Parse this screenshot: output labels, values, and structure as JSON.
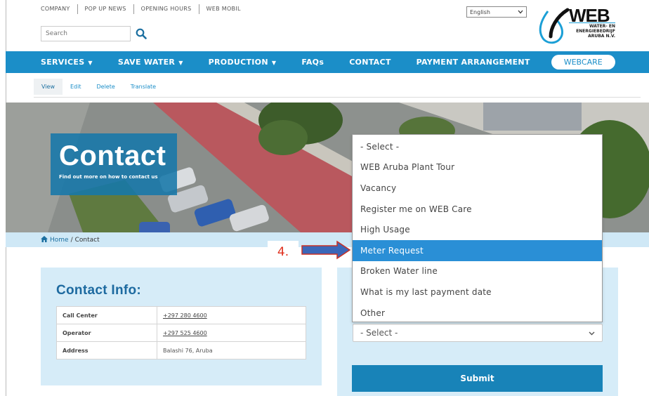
{
  "top_links": [
    "COMPANY",
    "POP UP NEWS",
    "OPENING HOURS",
    "WEB MOBIL"
  ],
  "search": {
    "placeholder": "Search"
  },
  "language": {
    "selected": "English"
  },
  "logo": {
    "text": "WEB",
    "subtitle_line1": "WATER- EN",
    "subtitle_line2": "ENERGIEBEDRIJF",
    "subtitle_line3": "ARUBA N.V."
  },
  "nav": {
    "items": [
      {
        "label": "SERVICES",
        "caret": "▼"
      },
      {
        "label": "SAVE WATER",
        "caret": "▼"
      },
      {
        "label": "PRODUCTION",
        "caret": "▼"
      },
      {
        "label": "FAQs",
        "caret": ""
      },
      {
        "label": "CONTACT",
        "caret": ""
      },
      {
        "label": "PAYMENT ARRANGEMENT",
        "caret": ""
      }
    ],
    "webcare": "WEBCARE"
  },
  "tabs": [
    "View",
    "Edit",
    "Delete",
    "Translate"
  ],
  "hero": {
    "title": "Contact",
    "subtitle": "Find out more on how to contact us"
  },
  "breadcrumb": {
    "home": "Home",
    "separator": "/",
    "current": "Contact"
  },
  "contact_info": {
    "title": "Contact Info:",
    "rows": [
      {
        "label": "Call Center",
        "value": "+297 280 4600"
      },
      {
        "label": "Operator",
        "value": "+297 525 4600"
      },
      {
        "label": "Address",
        "value": "Balashi 76, Aruba"
      }
    ]
  },
  "form": {
    "subject_select": {
      "value": "- Select -",
      "selected_option": "Meter Request"
    },
    "options": [
      "- Select -",
      "WEB Aruba Plant Tour",
      "Vacancy",
      "Register me on WEB Care",
      "High Usage",
      "Meter Request",
      "Broken Water line",
      "What is my last payment date",
      "Other"
    ],
    "second_select": {
      "value": "- Select -"
    },
    "submit_label": "Submit"
  },
  "annotation": {
    "label": "4.",
    "color": "#e0301e"
  },
  "colors": {
    "brand_blue": "#1b8ec8",
    "light_blue": "#d6ecf8",
    "highlight": "#2a8fd6"
  }
}
